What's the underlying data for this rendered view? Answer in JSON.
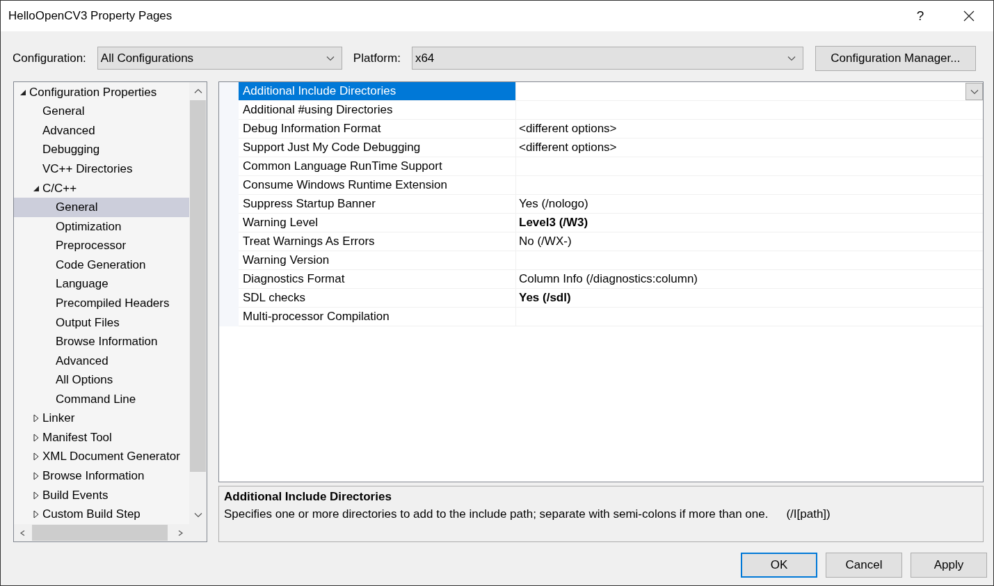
{
  "window": {
    "title": "HelloOpenCV3 Property Pages",
    "help": "?"
  },
  "toolbar": {
    "configuration_label": "Configuration:",
    "configuration_value": "All Configurations",
    "platform_label": "Platform:",
    "platform_value": "x64",
    "manager_button": "Configuration Manager..."
  },
  "tree": [
    {
      "label": "Configuration Properties",
      "expanded": true,
      "selected": false,
      "children": [
        {
          "label": "General",
          "selected": false
        },
        {
          "label": "Advanced",
          "selected": false
        },
        {
          "label": "Debugging",
          "selected": false
        },
        {
          "label": "VC++ Directories",
          "selected": false
        },
        {
          "label": "C/C++",
          "expanded": true,
          "selected": false,
          "children": [
            {
              "label": "General",
              "selected": true
            },
            {
              "label": "Optimization",
              "selected": false
            },
            {
              "label": "Preprocessor",
              "selected": false
            },
            {
              "label": "Code Generation",
              "selected": false
            },
            {
              "label": "Language",
              "selected": false
            },
            {
              "label": "Precompiled Headers",
              "selected": false
            },
            {
              "label": "Output Files",
              "selected": false
            },
            {
              "label": "Browse Information",
              "selected": false
            },
            {
              "label": "Advanced",
              "selected": false
            },
            {
              "label": "All Options",
              "selected": false
            },
            {
              "label": "Command Line",
              "selected": false
            }
          ]
        },
        {
          "label": "Linker",
          "expanded": false,
          "selected": false
        },
        {
          "label": "Manifest Tool",
          "expanded": false,
          "selected": false
        },
        {
          "label": "XML Document Generator",
          "expanded": false,
          "selected": false
        },
        {
          "label": "Browse Information",
          "expanded": false,
          "selected": false
        },
        {
          "label": "Build Events",
          "expanded": false,
          "selected": false
        },
        {
          "label": "Custom Build Step",
          "expanded": false,
          "selected": false
        }
      ]
    }
  ],
  "properties": [
    {
      "name": "Additional Include Directories",
      "selected": true
    },
    {
      "name": "Additional #using Directories",
      "selected": false
    },
    {
      "name": "Debug Information Format",
      "value": "<different options>",
      "selected": false,
      "modified": false
    },
    {
      "name": "Support Just My Code Debugging",
      "value": "<different options>",
      "selected": false,
      "modified": false
    },
    {
      "name": "Common Language RunTime Support",
      "selected": false
    },
    {
      "name": "Consume Windows Runtime Extension",
      "selected": false
    },
    {
      "name": "Suppress Startup Banner",
      "value": "Yes (/nologo)",
      "selected": false,
      "modified": false
    },
    {
      "name": "Warning Level",
      "value": "Level3 (/W3)",
      "selected": false,
      "modified": true
    },
    {
      "name": "Treat Warnings As Errors",
      "value": "No (/WX-)",
      "selected": false,
      "modified": false
    },
    {
      "name": "Warning Version",
      "selected": false
    },
    {
      "name": "Diagnostics Format",
      "value": "Column Info (/diagnostics:column)",
      "selected": false,
      "modified": false
    },
    {
      "name": "SDL checks",
      "value": "Yes (/sdl)",
      "selected": false,
      "modified": true
    },
    {
      "name": "Multi-processor Compilation",
      "selected": false
    }
  ],
  "description": {
    "title": "Additional Include Directories",
    "text": "Specifies one or more directories to add to the include path; separate with semi-colons if more than one.",
    "switch": "(/I[path])"
  },
  "buttons": [
    {
      "label": "OK",
      "default": true
    },
    {
      "label": "Cancel",
      "default": false
    },
    {
      "label": "Apply",
      "default": false
    }
  ]
}
